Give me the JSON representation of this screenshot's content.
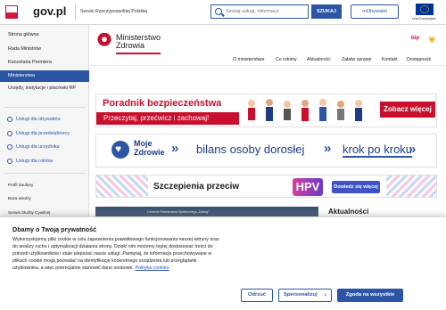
{
  "header": {
    "logo": "gov.pl",
    "service_label": "Serwis Rzeczypospolitej Polskiej",
    "search_placeholder": "Szukaj usługi, informacji",
    "search_button": "SZUKAJ",
    "mobywatel_button": "mObywatel",
    "eu_label": "Unia Europejska"
  },
  "sidebar": {
    "items": [
      {
        "label": "Strona główna"
      },
      {
        "label": "Rada Ministrów"
      },
      {
        "label": "Kancelaria Premiera"
      },
      {
        "label": "Ministerstwa"
      },
      {
        "label": "Urzędy, instytucje i placówki RP"
      }
    ],
    "active_index": 3,
    "services": [
      {
        "label": "Usługi dla obywatela",
        "icon": "user-icon"
      },
      {
        "label": "Usługi dla przedsiębiorcy",
        "icon": "briefcase-icon"
      },
      {
        "label": "Usługi dla urzędnika",
        "icon": "clerk-icon"
      },
      {
        "label": "Usługi dla rolnika",
        "icon": "farmer-icon"
      }
    ],
    "extra": [
      {
        "label": "Profil Zaufany"
      },
      {
        "label": "Baza wiedzy"
      },
      {
        "label": "Serwis Służby Cywilnej"
      }
    ]
  },
  "ministry": {
    "name_line1": "Ministerstwo",
    "name_line2": "Zdrowia",
    "bip": "bip",
    "sign_language": "🤟"
  },
  "nav": {
    "items": [
      "O ministerstwie",
      "Co robimy",
      "Aktualności",
      "Załatw sprawę",
      "Kontakt",
      "Dostępność"
    ]
  },
  "banners": {
    "b1_title": "Poradnik bezpieczeństwa",
    "b1_subtitle": "Przeczytaj, przećwicz i zachowaj!",
    "b1_cta": "Zobacz więcej",
    "b2_moje": "Moje",
    "b2_zdrowie": "Zdrowie",
    "b2_bilans": "bilans osoby dorosłej",
    "b2_krok": "krok po kroku",
    "b3_text": "Szczepienia przeciw",
    "b3_hpv": "HPV",
    "b3_cta": "Dowiedz się więcej",
    "photo_caption": "Centrum Partnerstwa Społecznego „Dialog”",
    "news_heading": "Aktualności"
  },
  "cookie": {
    "title": "Dbamy o Twoją prywatność",
    "text": "Wykorzystujemy pliki cookie w celu zapewnienia prawidłowego funkcjonowania naszej witryny oraz do analizy ruchu i optymalizacji działania strony. Dzięki nim możemy lepiej dostosować treści do potrzeb użytkowników i stale ulepszać nasze usługi. Pamiętaj, że informacje przechowywane w plikach cookie mogą pozwalać na identyfikację konkretnego urządzenia lub przeglądarki użytkownika, a więc potencjalnie stanowić dane osobowe.",
    "policy_link": "Polityka cookies",
    "reject_button": "Odrzuć",
    "personalize_button": "Spersonalizuj",
    "accept_button": "Zgoda na wszystkie"
  },
  "colors": {
    "primary": "#2c55a5",
    "red": "#c8102e",
    "sidebar_bg": "#f5f5f5"
  }
}
